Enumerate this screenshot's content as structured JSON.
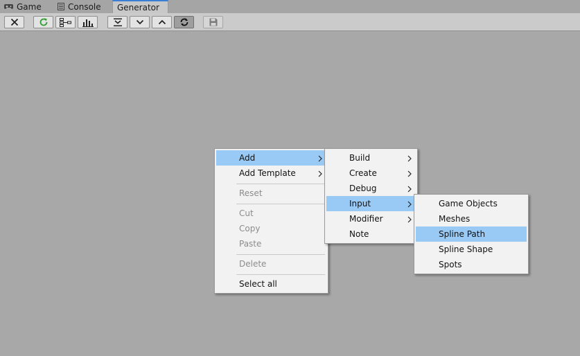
{
  "tabs": [
    {
      "label": "Game",
      "icon": "gamepad-icon",
      "active": false
    },
    {
      "label": "Console",
      "icon": "console-icon",
      "active": false
    },
    {
      "label": "Generator",
      "icon": "",
      "active": true
    }
  ],
  "toolbar": {
    "buttons": [
      {
        "name": "close-button",
        "icon": "close-icon"
      },
      {
        "name": "refresh-button",
        "icon": "refresh-icon",
        "color": "#2e9e2e"
      },
      {
        "name": "node-list-button",
        "icon": "node-list-icon"
      },
      {
        "name": "stats-button",
        "icon": "bar-chart-icon"
      },
      {
        "name": "collapse-all-button",
        "icon": "collapse-all-icon"
      },
      {
        "name": "expand-down-button",
        "icon": "chevron-down-icon"
      },
      {
        "name": "collapse-up-button",
        "icon": "chevron-up-icon"
      },
      {
        "name": "auto-sync-toggle",
        "icon": "sync-icon",
        "pressed": true
      },
      {
        "name": "save-button",
        "icon": "save-icon",
        "disabled": true
      }
    ]
  },
  "context_menu": {
    "items": [
      {
        "label": "Add",
        "submenu": true,
        "highlighted": true,
        "enabled": true
      },
      {
        "label": "Add Template",
        "submenu": true,
        "enabled": true
      },
      {
        "label": "Reset",
        "enabled": false
      },
      {
        "label": "Cut",
        "enabled": false
      },
      {
        "label": "Copy",
        "enabled": false
      },
      {
        "label": "Paste",
        "enabled": false
      },
      {
        "label": "Delete",
        "enabled": false
      },
      {
        "label": "Select all",
        "enabled": true
      }
    ]
  },
  "add_submenu": {
    "items": [
      {
        "label": "Build",
        "submenu": true
      },
      {
        "label": "Create",
        "submenu": true
      },
      {
        "label": "Debug",
        "submenu": true
      },
      {
        "label": "Input",
        "submenu": true,
        "highlighted": true
      },
      {
        "label": "Modifier",
        "submenu": true
      },
      {
        "label": "Note",
        "submenu": false
      }
    ]
  },
  "input_submenu": {
    "items": [
      {
        "label": "Game Objects"
      },
      {
        "label": "Meshes"
      },
      {
        "label": "Spline Path",
        "highlighted": true
      },
      {
        "label": "Spline Shape"
      },
      {
        "label": "Spots"
      }
    ]
  },
  "colors": {
    "highlight": "#99c9f5",
    "active_tab_accent": "#3a7fd5",
    "canvas": "#a8a8a8"
  }
}
